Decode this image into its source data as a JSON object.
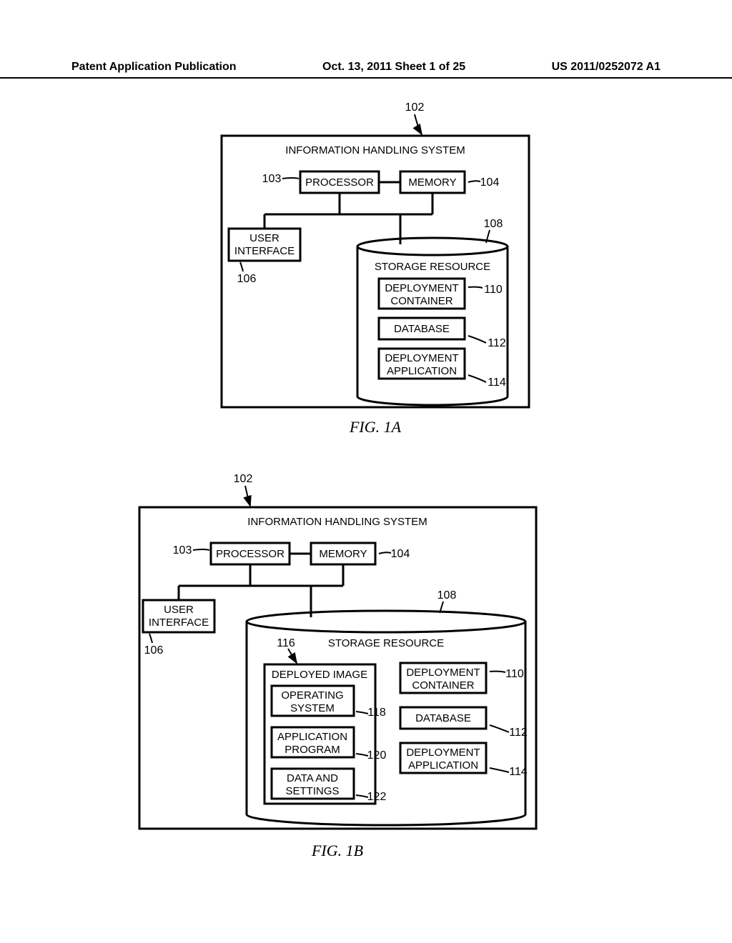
{
  "header": {
    "left": "Patent Application Publication",
    "center": "Oct. 13, 2011  Sheet 1 of 25",
    "right": "US 2011/0252072 A1"
  },
  "figA": {
    "caption": "FIG. 1A",
    "title": "INFORMATION HANDLING SYSTEM",
    "refs": {
      "system": "102",
      "processor": "103",
      "memory": "104",
      "ui": "106",
      "storage": "108",
      "deployContainer": "110",
      "database": "112",
      "deployApp": "114"
    },
    "labels": {
      "processor": "PROCESSOR",
      "memory": "MEMORY",
      "ui1": "USER",
      "ui2": "INTERFACE",
      "storage": "STORAGE RESOURCE",
      "dc1": "DEPLOYMENT",
      "dc2": "CONTAINER",
      "db": "DATABASE",
      "da1": "DEPLOYMENT",
      "da2": "APPLICATION"
    }
  },
  "figB": {
    "caption": "FIG. 1B",
    "title": "INFORMATION HANDLING SYSTEM",
    "refs": {
      "system": "102",
      "processor": "103",
      "memory": "104",
      "ui": "106",
      "storage": "108",
      "deployContainer": "110",
      "database": "112",
      "deployApp": "114",
      "deployedImage": "116",
      "os": "118",
      "appProg": "120",
      "dataSettings": "122"
    },
    "labels": {
      "processor": "PROCESSOR",
      "memory": "MEMORY",
      "ui1": "USER",
      "ui2": "INTERFACE",
      "storage": "STORAGE RESOURCE",
      "di": "DEPLOYED IMAGE",
      "os1": "OPERATING",
      "os2": "SYSTEM",
      "ap1": "APPLICATION",
      "ap2": "PROGRAM",
      "ds1": "DATA AND",
      "ds2": "SETTINGS",
      "dc1": "DEPLOYMENT",
      "dc2": "CONTAINER",
      "db": "DATABASE",
      "da1": "DEPLOYMENT",
      "da2": "APPLICATION"
    }
  }
}
